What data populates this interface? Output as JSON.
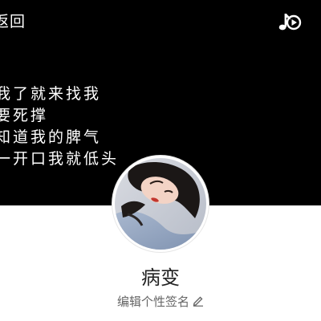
{
  "header": {
    "back_label": "返回",
    "music_icon": "music-note-play-icon",
    "background_color": "#000000"
  },
  "cover": {
    "lines": [
      "我了就来找我",
      "要死撑",
      "知道我的脾气",
      "一开口我就低头"
    ]
  },
  "profile": {
    "username": "病变",
    "signature_placeholder": "编辑个性签名",
    "edit_icon": "pencil-icon"
  }
}
